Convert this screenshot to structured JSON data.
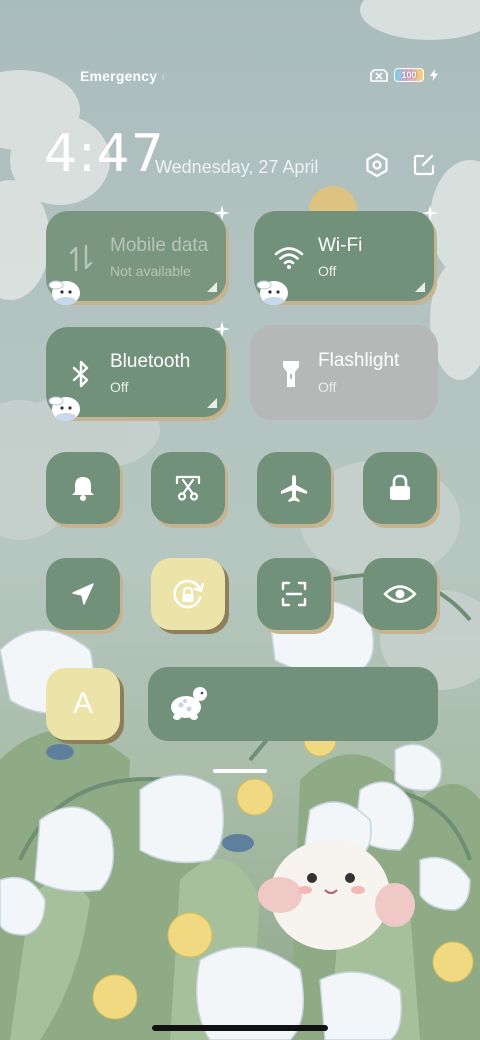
{
  "status_bar": {
    "carrier": "Emergency calls only",
    "battery_level": "100",
    "icons": [
      "sim-off-icon",
      "battery-icon",
      "charging-bolt-icon"
    ]
  },
  "header": {
    "time": "4:47",
    "date": "Wednesday, 27 April",
    "icons": [
      "settings-hexagon-icon",
      "edit-icon"
    ]
  },
  "tiles": {
    "mobile_data": {
      "label": "Mobile data",
      "status": "Not available",
      "icon": "mobile-data-arrows-icon"
    },
    "wifi": {
      "label": "Wi-Fi",
      "status": "Off",
      "icon": "wifi-icon"
    },
    "bluetooth": {
      "label": "Bluetooth",
      "status": "Off",
      "icon": "bluetooth-icon"
    },
    "flashlight": {
      "label": "Flashlight",
      "status": "Off",
      "icon": "flashlight-icon"
    }
  },
  "toggles": [
    {
      "name": "sound",
      "icon": "bell-icon"
    },
    {
      "name": "screenshot",
      "icon": "scissors-icon"
    },
    {
      "name": "airplane-mode",
      "icon": "airplane-icon"
    },
    {
      "name": "lock-screen",
      "icon": "lock-icon"
    },
    {
      "name": "location",
      "icon": "location-arrow-icon"
    },
    {
      "name": "rotation-lock",
      "icon": "rotation-lock-icon",
      "active": true
    },
    {
      "name": "scanner",
      "icon": "scan-icon"
    },
    {
      "name": "reading-mode",
      "icon": "eye-icon"
    }
  ],
  "font_tile": {
    "letter": "A",
    "active": true
  },
  "brightness": {
    "icon": "turtle-icon"
  },
  "colors": {
    "tile_on": "#72917a",
    "tile_off": "#b5b8b6",
    "tile_shadow": "#c6b490",
    "active_tile": "#ece3a8",
    "text": "#ffffff"
  }
}
